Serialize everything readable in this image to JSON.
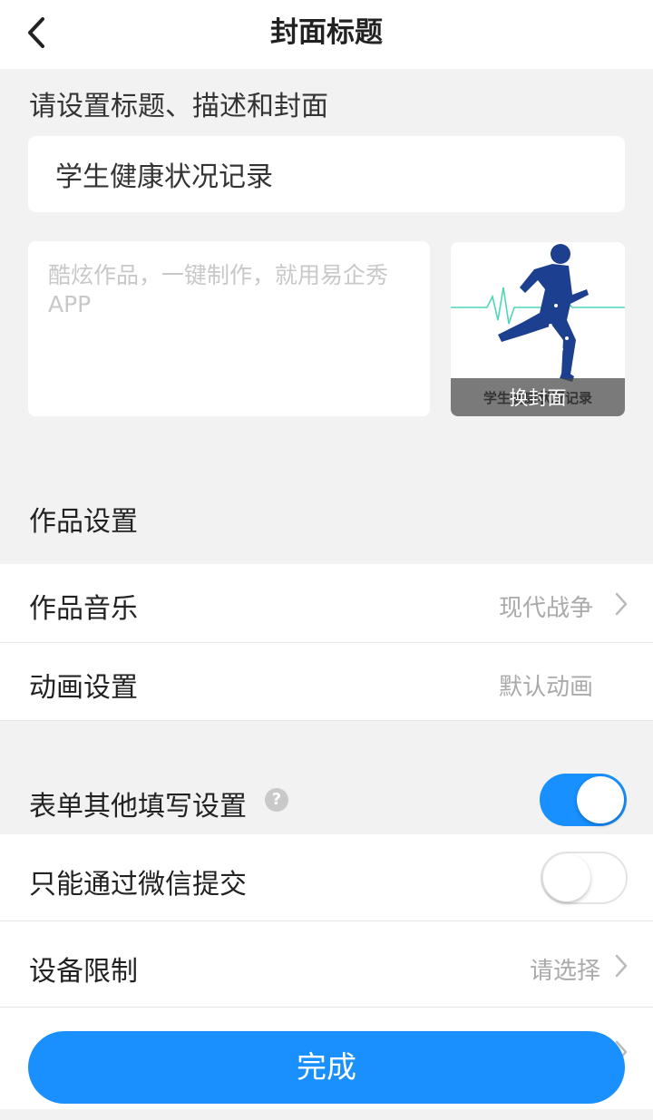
{
  "header": {
    "title": "封面标题"
  },
  "hint": "请设置标题、描述和封面",
  "title_input": {
    "value": "学生健康状况记录"
  },
  "description_input": {
    "placeholder": "酷炫作品，一键制作，就用易企秀APP",
    "value": ""
  },
  "cover": {
    "bg_text": "学生健康状况记录",
    "change_label": "换封面"
  },
  "work_settings": {
    "group_title": "作品设置",
    "music": {
      "label": "作品音乐",
      "value": "现代战争"
    },
    "animation": {
      "label": "动画设置",
      "value": "默认动画"
    }
  },
  "form_settings": {
    "other": {
      "label": "表单其他填写设置",
      "help": "?",
      "enabled": true
    },
    "wechat_only": {
      "label": "只能通过微信提交",
      "enabled": false
    },
    "device_limit": {
      "label": "设备限制",
      "value": "请选择"
    }
  },
  "done_button": {
    "label": "完成"
  },
  "colors": {
    "accent": "#1a8ffe",
    "background": "#f2f2f2",
    "cover_figure": "#1d3f8f",
    "ecg_line": "#4fd6b7"
  }
}
